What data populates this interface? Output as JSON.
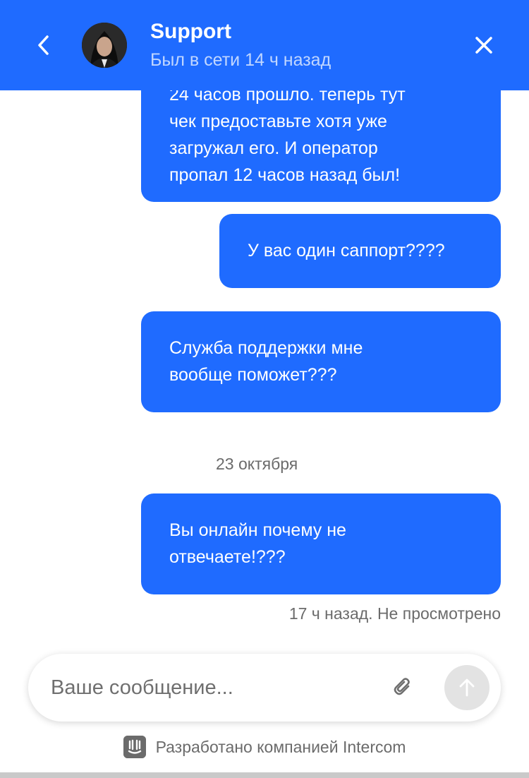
{
  "header": {
    "title": "Support",
    "subtitle": "Был в сети 14 ч назад",
    "back_icon": "chevron-left-icon",
    "close_icon": "close-icon",
    "accent_color": "#1f6bff"
  },
  "messages": [
    {
      "lines": [
        "24 часов прошло. теперь тут",
        "чек предоставьте хотя уже",
        "загружал его. И оператор",
        "пропал 12 часов назад был!"
      ]
    },
    {
      "lines": [
        "У вас один саппорт????"
      ]
    },
    {
      "lines": [
        "Служба поддержки мне",
        "вообще поможет???"
      ]
    },
    {
      "lines": [
        "Вы онлайн почему не",
        "отвечаете!???"
      ]
    }
  ],
  "date_separator": "23 октября",
  "last_status": "17 ч назад. Не просмотрено",
  "composer": {
    "placeholder": "Ваше сообщение...",
    "attach_icon": "paperclip-icon",
    "send_icon": "arrow-up-icon"
  },
  "footer": {
    "text": "Разработано компанией Intercom",
    "logo_icon": "intercom-logo-icon"
  }
}
